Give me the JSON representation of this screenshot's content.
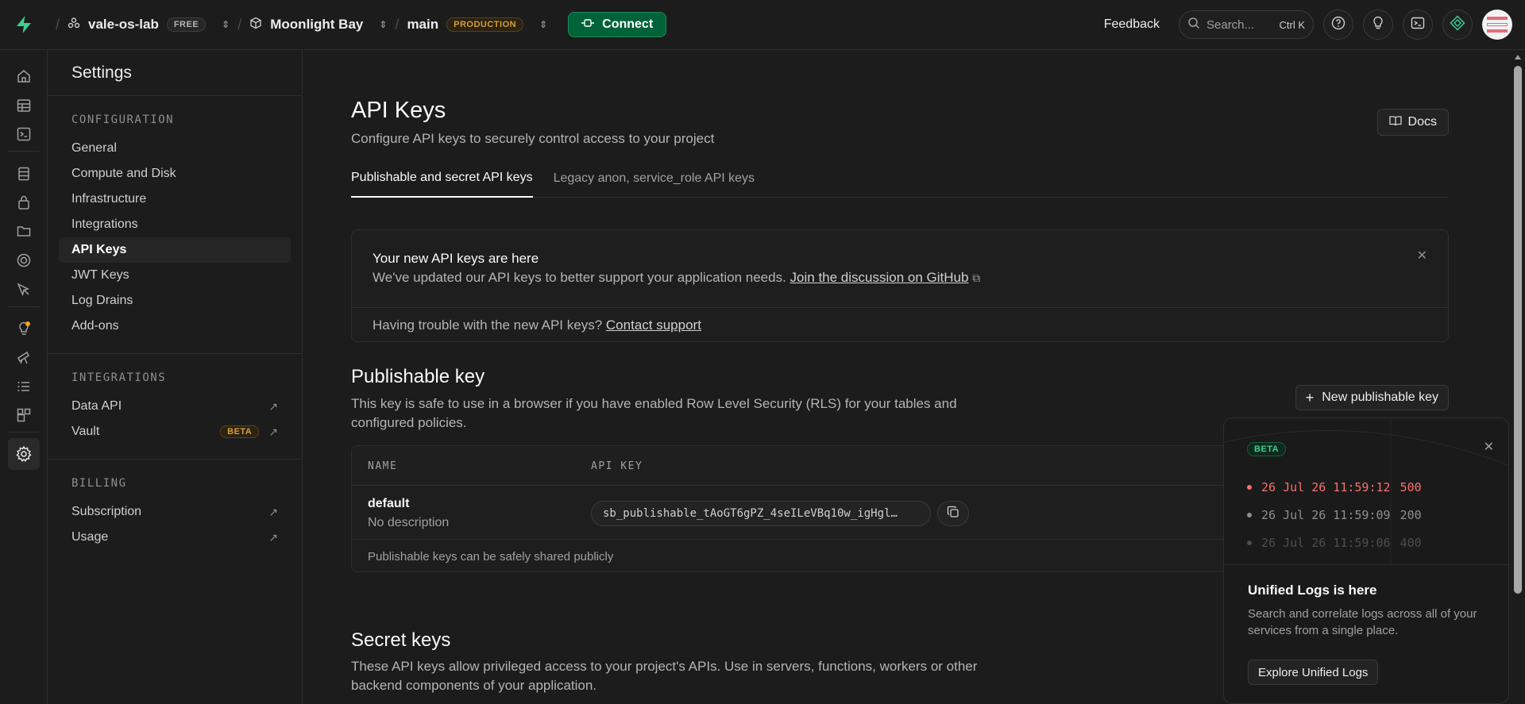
{
  "topbar": {
    "org_name": "vale-os-lab",
    "org_plan": "FREE",
    "project_name": "Moonlight Bay",
    "branch_name": "main",
    "branch_env": "PRODUCTION",
    "connect_label": "Connect",
    "feedback_label": "Feedback",
    "search_placeholder": "Search...",
    "search_shortcut": "Ctrl K"
  },
  "sidebar": {
    "title": "Settings",
    "groups": [
      {
        "title": "CONFIGURATION",
        "items": [
          "General",
          "Compute and Disk",
          "Infrastructure",
          "Integrations",
          "API Keys",
          "JWT Keys",
          "Log Drains",
          "Add-ons"
        ]
      },
      {
        "title": "INTEGRATIONS",
        "items": [
          "Data API",
          "Vault"
        ],
        "vault_badge": "BETA"
      },
      {
        "title": "BILLING",
        "items": [
          "Subscription",
          "Usage"
        ]
      }
    ]
  },
  "page": {
    "title": "API Keys",
    "subtitle": "Configure API keys to securely control access to your project",
    "docs_label": "Docs",
    "tabs": [
      "Publishable and secret API keys",
      "Legacy anon, service_role API keys"
    ]
  },
  "notice": {
    "title": "Your new API keys are here",
    "text": "We've updated our API keys to better support your application needs.",
    "link": "Join the discussion on GitHub",
    "footer_text": "Having trouble with the new API keys?",
    "footer_link": "Contact support"
  },
  "publishable": {
    "title": "Publishable key",
    "description": "This key is safe to use in a browser if you have enabled Row Level Security (RLS) for your tables and configured policies.",
    "new_button": "New publishable key",
    "columns": [
      "NAME",
      "API KEY"
    ],
    "rows": [
      {
        "name": "default",
        "description": "No description",
        "key": "sb_publishable_tAoGT6gPZ_4seILeVBq10w_igHgl…"
      }
    ],
    "footer": "Publishable keys can be safely shared publicly"
  },
  "secret": {
    "title": "Secret keys",
    "description": "These API keys allow privileged access to your project's APIs. Use in servers, functions, workers or other backend components of your application."
  },
  "popup": {
    "badge": "BETA",
    "logs": [
      {
        "time": "26 Jul 26 11:59:12",
        "status": "500",
        "color": "#f87171"
      },
      {
        "time": "26 Jul 26 11:59:09",
        "status": "200",
        "color": "#8f8f8f"
      },
      {
        "time": "26 Jul 26 11:59:06",
        "status": "400",
        "color": "#4d4d4d"
      }
    ],
    "title": "Unified Logs is here",
    "text": "Search and correlate logs across all of your services from a single place.",
    "button": "Explore Unified Logs"
  },
  "colors": {
    "brand_green": "#3ecf8e",
    "connect_bg": "#006239",
    "warning": "#d69d35",
    "error": "#f87171"
  }
}
